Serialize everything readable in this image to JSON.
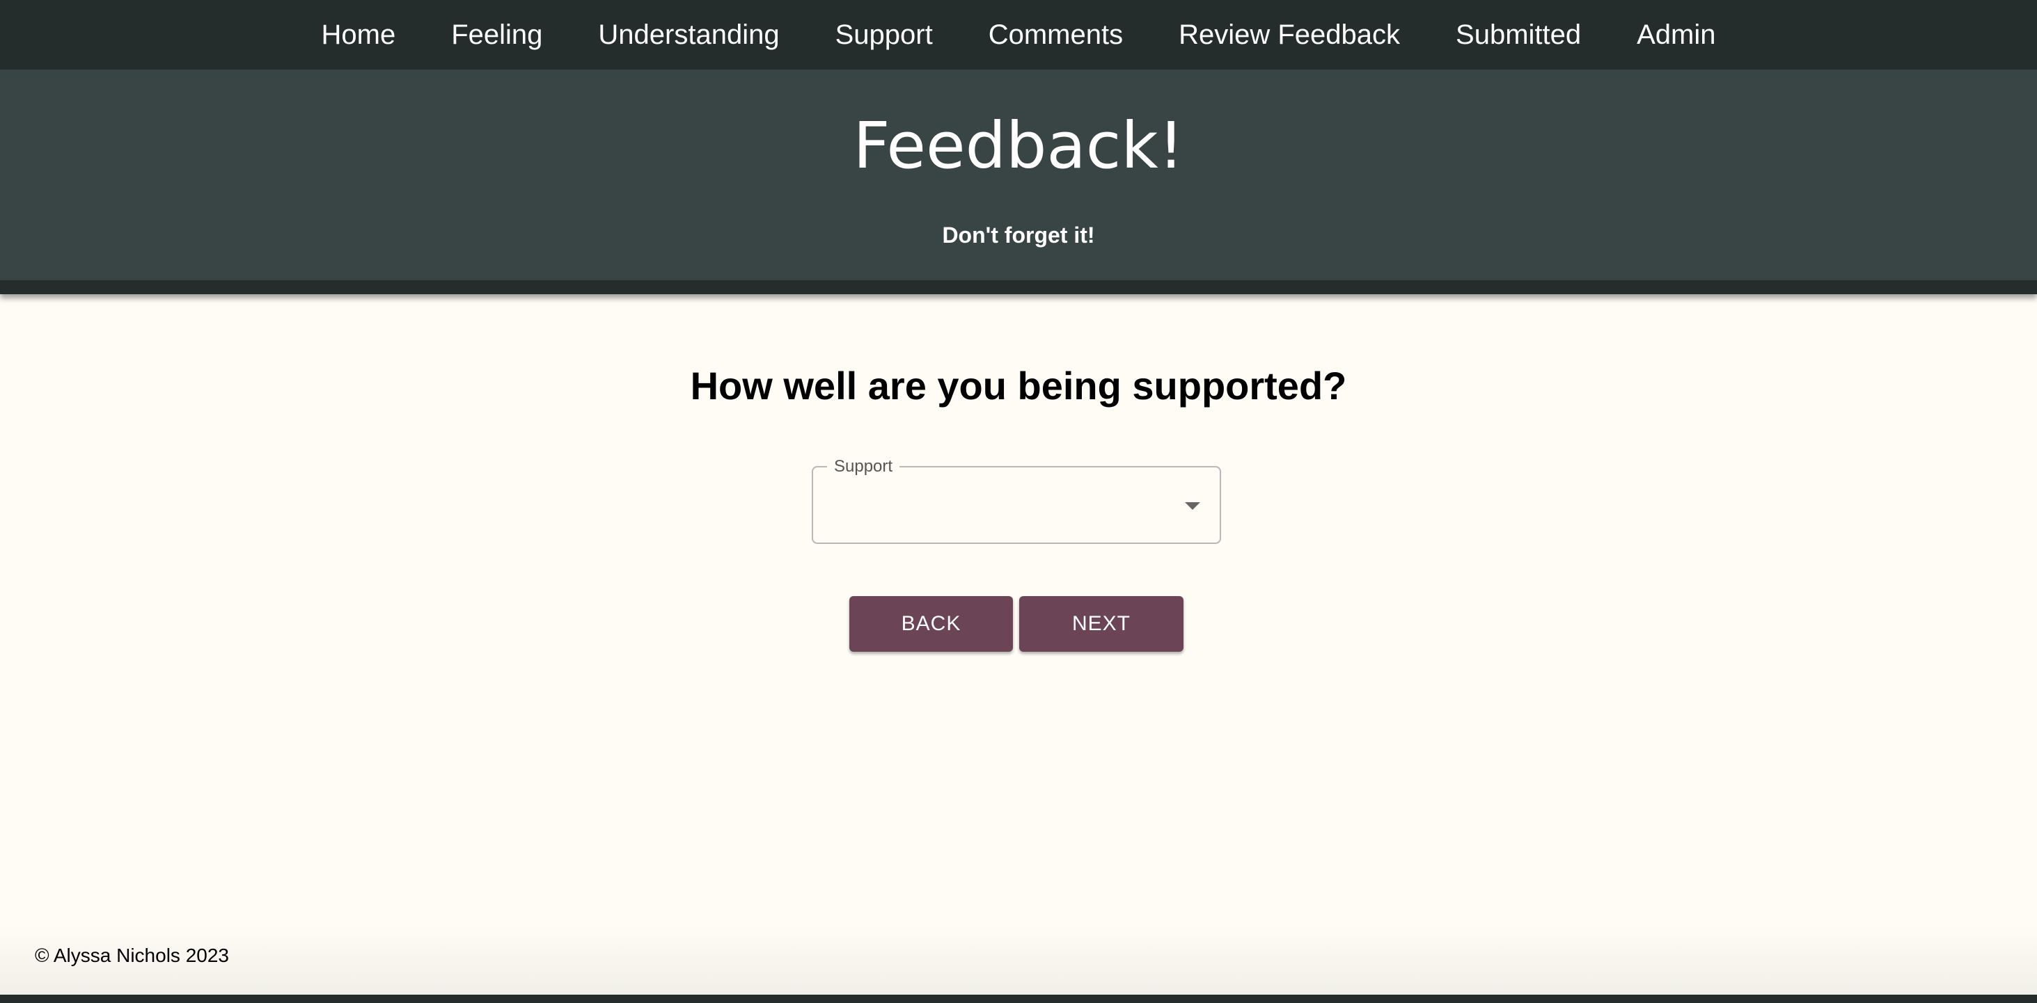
{
  "nav": {
    "items": [
      {
        "label": "Home"
      },
      {
        "label": "Feeling"
      },
      {
        "label": "Understanding"
      },
      {
        "label": "Support"
      },
      {
        "label": "Comments"
      },
      {
        "label": "Review Feedback"
      },
      {
        "label": "Submitted"
      },
      {
        "label": "Admin"
      }
    ]
  },
  "header": {
    "title": "Feedback!",
    "subtitle": "Don't forget it!"
  },
  "main": {
    "question": "How well are you being supported?",
    "support_select": {
      "label": "Support",
      "value": ""
    },
    "back_label": "BACK",
    "next_label": "NEXT"
  },
  "footer": {
    "copyright": "© Alyssa Nichols 2023"
  },
  "colors": {
    "nav_bg": "#252d2c",
    "hero_bg": "#384544",
    "page_bg": "#fffbf5",
    "button_bg": "#6b4556"
  },
  "icons": {
    "select_arrow": "chevron-down-icon"
  }
}
